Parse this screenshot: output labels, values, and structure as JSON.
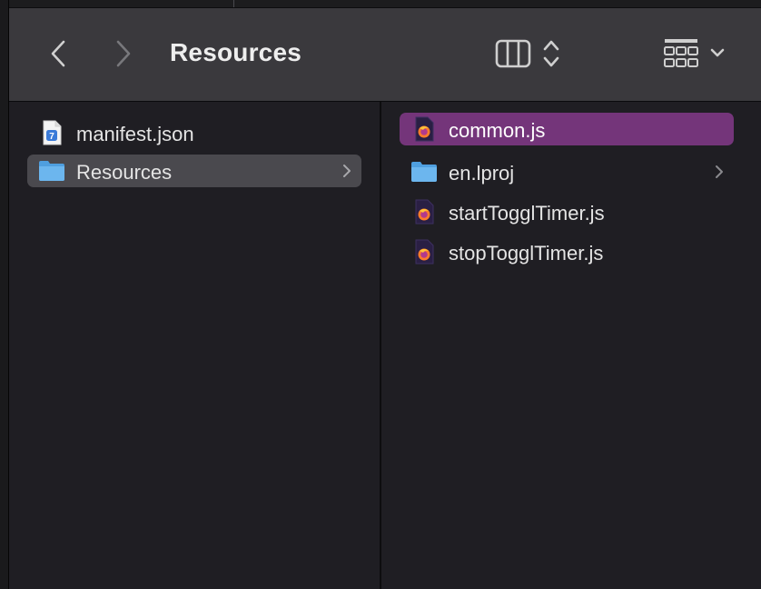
{
  "window": {
    "title": "Resources"
  },
  "toolbar": {
    "back_icon": "chevron-left-icon",
    "forward_icon": "chevron-right-icon",
    "view_mode_icon": "column-view-icon",
    "group_icon": "grid-group-icon"
  },
  "columns": [
    {
      "items": [
        {
          "label": "manifest.json",
          "icon": "json-file-icon",
          "selected": false,
          "has_children": false
        },
        {
          "label": "Resources",
          "icon": "folder-icon",
          "selected": true,
          "has_children": true
        }
      ]
    },
    {
      "items": [
        {
          "label": "common.js",
          "icon": "js-file-icon",
          "selected": true,
          "has_children": false
        },
        {
          "label": "en.lproj",
          "icon": "folder-icon",
          "selected": false,
          "has_children": true
        },
        {
          "label": "startTogglTimer.js",
          "icon": "js-file-icon",
          "selected": false,
          "has_children": false
        },
        {
          "label": "stopTogglTimer.js",
          "icon": "js-file-icon",
          "selected": false,
          "has_children": false
        }
      ]
    }
  ],
  "colors": {
    "window_bg": "#1f1e23",
    "toolbar_bg": "#3a393d",
    "selection_active": "#74357a",
    "selection_inactive": "#4a494e",
    "folder_blue": "#5aa9e6"
  }
}
